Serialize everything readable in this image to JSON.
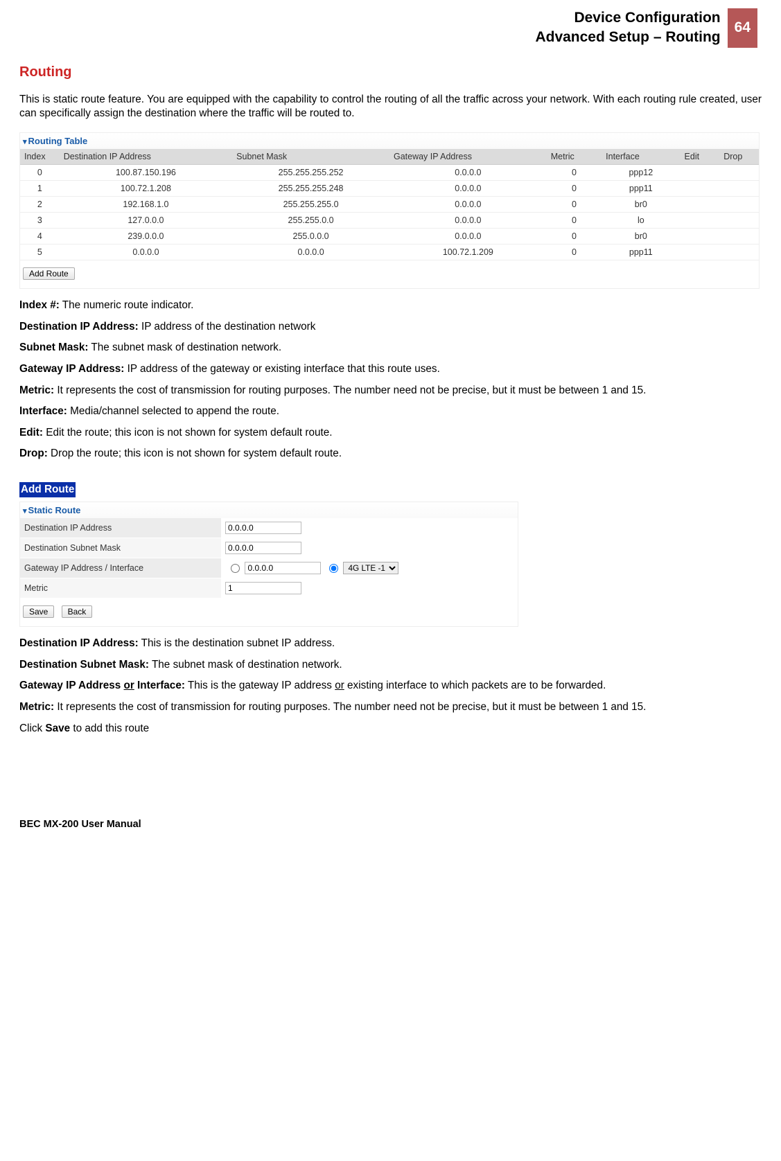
{
  "header": {
    "line1": "Device Configuration",
    "line2": "Advanced Setup – Routing",
    "page_number": "64"
  },
  "section_title": "Routing",
  "intro": "This is static route feature. You are equipped with the capability to control the routing of all the traffic across your network. With each routing rule created, user can specifically assign the destination where the traffic will be routed to.",
  "routing_table": {
    "title": "Routing Table",
    "columns": {
      "index": "Index",
      "dest": "Destination IP Address",
      "mask": "Subnet Mask",
      "gw": "Gateway IP Address",
      "metric": "Metric",
      "iface": "Interface",
      "edit": "Edit",
      "drop": "Drop"
    },
    "rows": [
      {
        "index": "0",
        "dest": "100.87.150.196",
        "mask": "255.255.255.252",
        "gw": "0.0.0.0",
        "metric": "0",
        "iface": "ppp12"
      },
      {
        "index": "1",
        "dest": "100.72.1.208",
        "mask": "255.255.255.248",
        "gw": "0.0.0.0",
        "metric": "0",
        "iface": "ppp11"
      },
      {
        "index": "2",
        "dest": "192.168.1.0",
        "mask": "255.255.255.0",
        "gw": "0.0.0.0",
        "metric": "0",
        "iface": "br0"
      },
      {
        "index": "3",
        "dest": "127.0.0.0",
        "mask": "255.255.0.0",
        "gw": "0.0.0.0",
        "metric": "0",
        "iface": "lo"
      },
      {
        "index": "4",
        "dest": "239.0.0.0",
        "mask": "255.0.0.0",
        "gw": "0.0.0.0",
        "metric": "0",
        "iface": "br0"
      },
      {
        "index": "5",
        "dest": "0.0.0.0",
        "mask": "0.0.0.0",
        "gw": "100.72.1.209",
        "metric": "0",
        "iface": "ppp11"
      }
    ],
    "add_route_btn": "Add Route"
  },
  "descriptions1": {
    "index_label": "Index #:",
    "index_text": " The numeric route indicator.",
    "dest_label": "Destination IP Address:",
    "dest_text": " IP address of the destination network",
    "mask_label": "Subnet Mask:",
    "mask_text": " The subnet mask of destination network.",
    "gw_label": "Gateway IP Address:",
    "gw_text": " IP address of the gateway or existing interface that this route uses.",
    "metric_label": "Metric:",
    "metric_text": " It represents the cost of transmission for routing purposes. The number need not be precise, but it must be between 1 and 15.",
    "iface_label": "Interface:",
    "iface_text": " Media/channel selected to append the route.",
    "edit_label": "Edit:",
    "edit_text": " Edit the route; this icon is not shown for system default route.",
    "drop_label": "Drop:",
    "drop_text": " Drop the route; this icon is not shown for system default route."
  },
  "add_route_section": {
    "header": "Add Route",
    "panel_title": "Static Route",
    "fields": {
      "dest_ip_label": "Destination IP Address",
      "dest_ip_value": "0.0.0.0",
      "dest_mask_label": "Destination Subnet Mask",
      "dest_mask_value": "0.0.0.0",
      "gw_label": "Gateway IP Address / Interface",
      "gw_ip_value": "0.0.0.0",
      "gw_iface_value": "4G LTE -1",
      "metric_label": "Metric",
      "metric_value": "1"
    },
    "save_btn": "Save",
    "back_btn": "Back"
  },
  "descriptions2": {
    "dest_label": "Destination IP Address:",
    "dest_text": " This is the destination subnet IP address.",
    "mask_label": "Destination Subnet Mask:",
    "mask_text": " The subnet mask of destination network.",
    "gw_label_pre": "Gateway IP Address ",
    "gw_label_or": "or",
    "gw_label_post": " Interface:",
    "gw_text_pre": " This is the gateway IP address ",
    "gw_text_or": "or",
    "gw_text_post": " existing interface to which packets are to be forwarded.",
    "metric_label": "Metric:",
    "metric_text": " It represents the cost of transmission for routing purposes. The number need not be precise, but it must be between 1 and 15.",
    "click_pre": "Click ",
    "click_btn": "Save",
    "click_post": " to add this route"
  },
  "footer": "BEC MX-200 User Manual"
}
